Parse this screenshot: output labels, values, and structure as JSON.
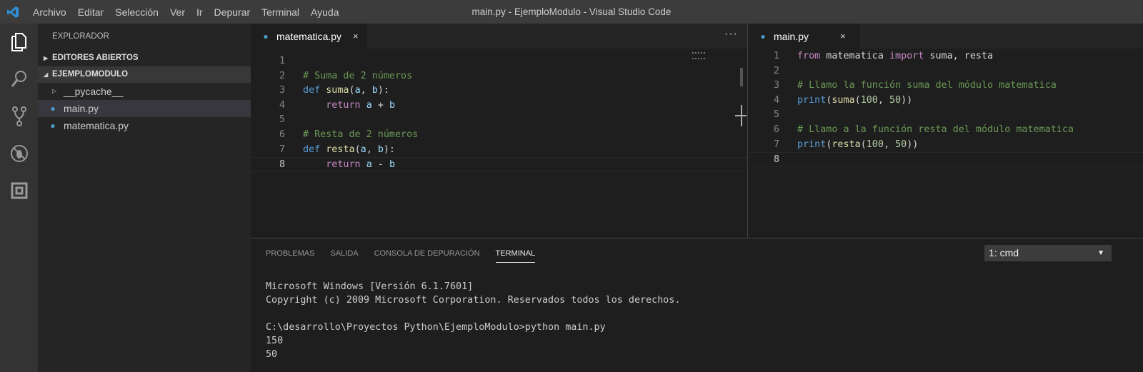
{
  "titlebar": {
    "menu": [
      "Archivo",
      "Editar",
      "Selección",
      "Ver",
      "Ir",
      "Depurar",
      "Terminal",
      "Ayuda"
    ],
    "title": "main.py - EjemploModulo - Visual Studio Code"
  },
  "activity": [
    "files-icon",
    "search-icon",
    "source-control-icon",
    "debug-icon",
    "extensions-icon"
  ],
  "sidebar": {
    "header": "EXPLORADOR",
    "open_editors": "EDITORES ABIERTOS",
    "folder": "EJEMPLOMODULO",
    "items": [
      {
        "label": "__pycache__",
        "type": "folder"
      },
      {
        "label": "main.py",
        "type": "py"
      },
      {
        "label": "matematica.py",
        "type": "py"
      }
    ]
  },
  "editor1": {
    "tab": "matematica.py",
    "close": "×",
    "more": "···",
    "lines": [
      [],
      [
        [
          "# Suma de 2 números",
          "c"
        ]
      ],
      [
        [
          "def",
          "k"
        ],
        [
          " ",
          ""
        ],
        [
          "suma",
          "f"
        ],
        [
          "(",
          ""
        ],
        [
          "a",
          "p"
        ],
        [
          ", ",
          ""
        ],
        [
          "b",
          "p"
        ],
        [
          "):",
          ""
        ]
      ],
      [
        [
          "    ",
          ""
        ],
        [
          "return",
          "r"
        ],
        [
          " ",
          ""
        ],
        [
          "a",
          "p"
        ],
        [
          " + ",
          ""
        ],
        [
          "b",
          "p"
        ]
      ],
      [],
      [
        [
          "# Resta de 2 números",
          "c"
        ]
      ],
      [
        [
          "def",
          "k"
        ],
        [
          " ",
          ""
        ],
        [
          "resta",
          "f"
        ],
        [
          "(",
          ""
        ],
        [
          "a",
          "p"
        ],
        [
          ", ",
          ""
        ],
        [
          "b",
          "p"
        ],
        [
          "):",
          ""
        ]
      ],
      [
        [
          "    ",
          ""
        ],
        [
          "return",
          "r"
        ],
        [
          " ",
          ""
        ],
        [
          "a",
          "p"
        ],
        [
          " - ",
          ""
        ],
        [
          "b",
          "p"
        ]
      ]
    ],
    "current": 8
  },
  "editor2": {
    "tab": "main.py",
    "close": "×",
    "lines": [
      [
        [
          "from",
          "r"
        ],
        [
          " matematica ",
          ""
        ],
        [
          "import",
          "r"
        ],
        [
          " suma, resta",
          ""
        ]
      ],
      [],
      [
        [
          "# Llamo la función suma del módulo matematica",
          "c"
        ]
      ],
      [
        [
          "print",
          "k"
        ],
        [
          "(",
          ""
        ],
        [
          "suma",
          "f"
        ],
        [
          "(",
          ""
        ],
        [
          "100",
          "n"
        ],
        [
          ", ",
          ""
        ],
        [
          "50",
          "n"
        ],
        [
          "))",
          ""
        ]
      ],
      [],
      [
        [
          "# Llamo a la función resta del módulo matematica",
          "c"
        ]
      ],
      [
        [
          "print",
          "k"
        ],
        [
          "(",
          ""
        ],
        [
          "resta",
          "f"
        ],
        [
          "(",
          ""
        ],
        [
          "100",
          "n"
        ],
        [
          ", ",
          ""
        ],
        [
          "50",
          "n"
        ],
        [
          "))",
          ""
        ]
      ],
      []
    ],
    "current": 8
  },
  "panel": {
    "tabs": [
      "PROBLEMAS",
      "SALIDA",
      "CONSOLA DE DEPURACIÓN",
      "TERMINAL"
    ],
    "active": 3,
    "terminal_select": "1: cmd",
    "terminal_lines": [
      "Microsoft Windows [Versión 6.1.7601]",
      "Copyright (c) 2009 Microsoft Corporation. Reservados todos los derechos.",
      "",
      "C:\\desarrollo\\Proyectos Python\\EjemploModulo>python main.py",
      "150",
      "50"
    ]
  }
}
